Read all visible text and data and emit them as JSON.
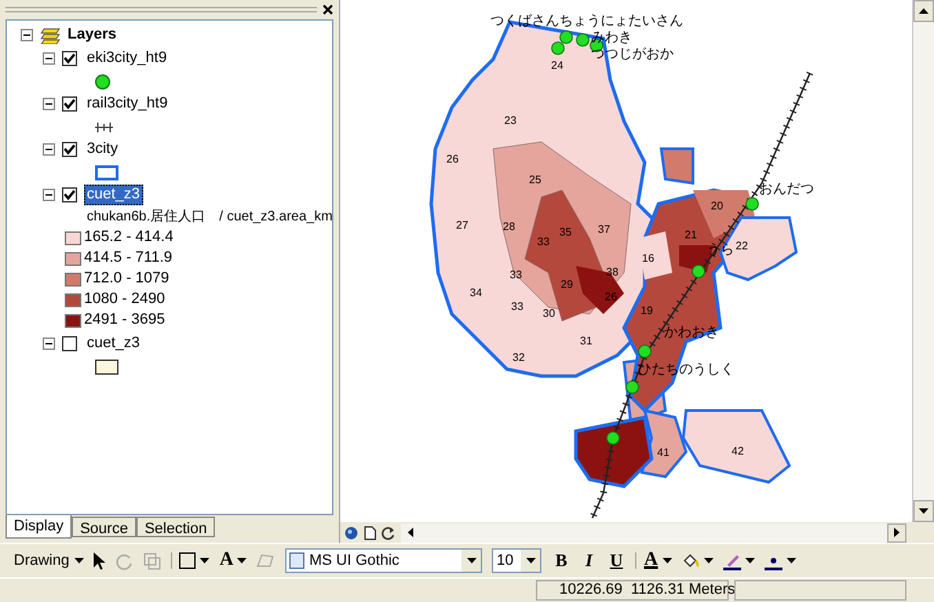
{
  "toc": {
    "root": {
      "label": "Layers",
      "expanded": true
    },
    "layers": [
      {
        "name": "eki3city_ht9",
        "checked": true,
        "expanded": true,
        "selected": false,
        "kind": "point"
      },
      {
        "name": "rail3city_ht9",
        "checked": true,
        "expanded": true,
        "selected": false,
        "kind": "rail"
      },
      {
        "name": "3city",
        "checked": true,
        "expanded": true,
        "selected": false,
        "kind": "outline"
      },
      {
        "name": "cuet_z3",
        "checked": true,
        "expanded": true,
        "selected": true,
        "kind": "classes",
        "field": "chukan6b.居住人口　/ cuet_z3.area_km",
        "classes": [
          {
            "label": "165.2 - 414.4",
            "color": "#f8d8d6"
          },
          {
            "label": "414.5 - 711.9",
            "color": "#e5a59c"
          },
          {
            "label": "712.0 - 1079",
            "color": "#d27b6c"
          },
          {
            "label": "1080 - 2490",
            "color": "#b5483c"
          },
          {
            "label": "2491 - 3695",
            "color": "#8c1212"
          }
        ]
      },
      {
        "name": "cuet_z3",
        "checked": false,
        "expanded": true,
        "selected": false,
        "kind": "fill"
      }
    ],
    "tabs": [
      {
        "label": "Display",
        "selected": true
      },
      {
        "label": "Source",
        "selected": false
      },
      {
        "label": "Selection",
        "selected": false
      }
    ]
  },
  "map": {
    "zone_labels": [
      "24",
      "23",
      "26",
      "25",
      "27",
      "28",
      "33",
      "35",
      "37",
      "20",
      "21",
      "16",
      "22",
      "33",
      "29",
      "38",
      "34",
      "33",
      "26",
      "30",
      "19",
      "31",
      "32",
      "41",
      "42"
    ],
    "station_labels": [
      "つくばさんちょうにょたいさん",
      "みわき",
      "つつじがおか",
      "おんだつ",
      "うら",
      "かわおき",
      "ひたちのうしく"
    ]
  },
  "drawing_toolbar": {
    "drawing_menu": "Drawing",
    "font": "MS UI Gothic",
    "size": "10",
    "bold": "B",
    "italic": "I",
    "underline": "U",
    "text_tool": "A",
    "font_color": "A"
  },
  "status_bar": {
    "coordinates": "10226.69  1126.31 Meters"
  }
}
